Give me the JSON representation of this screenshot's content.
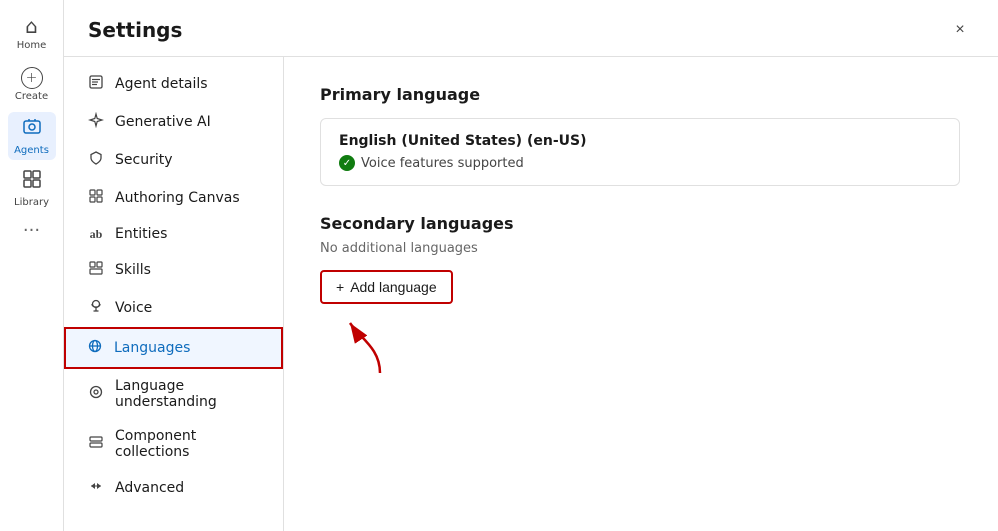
{
  "app": {
    "title": "Settings",
    "close_label": "×"
  },
  "left_nav": {
    "items": [
      {
        "id": "home",
        "label": "Home",
        "icon": "⌂",
        "active": false
      },
      {
        "id": "create",
        "label": "Create",
        "icon": "+",
        "active": false,
        "circle": true
      },
      {
        "id": "agents",
        "label": "Agents",
        "icon": "◈",
        "active": true
      },
      {
        "id": "library",
        "label": "Library",
        "icon": "⊞",
        "active": false
      }
    ],
    "more_label": "···"
  },
  "settings_sidebar": {
    "items": [
      {
        "id": "agent-details",
        "label": "Agent details",
        "icon": "☰",
        "active": false
      },
      {
        "id": "generative-ai",
        "label": "Generative AI",
        "icon": "✦",
        "active": false
      },
      {
        "id": "security",
        "label": "Security",
        "icon": "🔒",
        "active": false
      },
      {
        "id": "authoring-canvas",
        "label": "Authoring Canvas",
        "icon": "⊞",
        "active": false
      },
      {
        "id": "entities",
        "label": "Entities",
        "icon": "ab",
        "active": false
      },
      {
        "id": "skills",
        "label": "Skills",
        "icon": "▦",
        "active": false
      },
      {
        "id": "voice",
        "label": "Voice",
        "icon": "☺",
        "active": false
      },
      {
        "id": "languages",
        "label": "Languages",
        "icon": "⌘",
        "active": true,
        "highlighted": true
      },
      {
        "id": "language-understanding",
        "label": "Language understanding",
        "icon": "⊙",
        "active": false
      },
      {
        "id": "component-collections",
        "label": "Component collections",
        "icon": "⧉",
        "active": false
      },
      {
        "id": "advanced",
        "label": "Advanced",
        "icon": "⇌",
        "active": false
      }
    ]
  },
  "content": {
    "primary_language": {
      "section_title": "Primary language",
      "language_name": "English (United States) (en-US)",
      "voice_label": "Voice features supported"
    },
    "secondary_languages": {
      "section_title": "Secondary languages",
      "empty_label": "No additional languages",
      "add_button_label": "Add language"
    }
  }
}
